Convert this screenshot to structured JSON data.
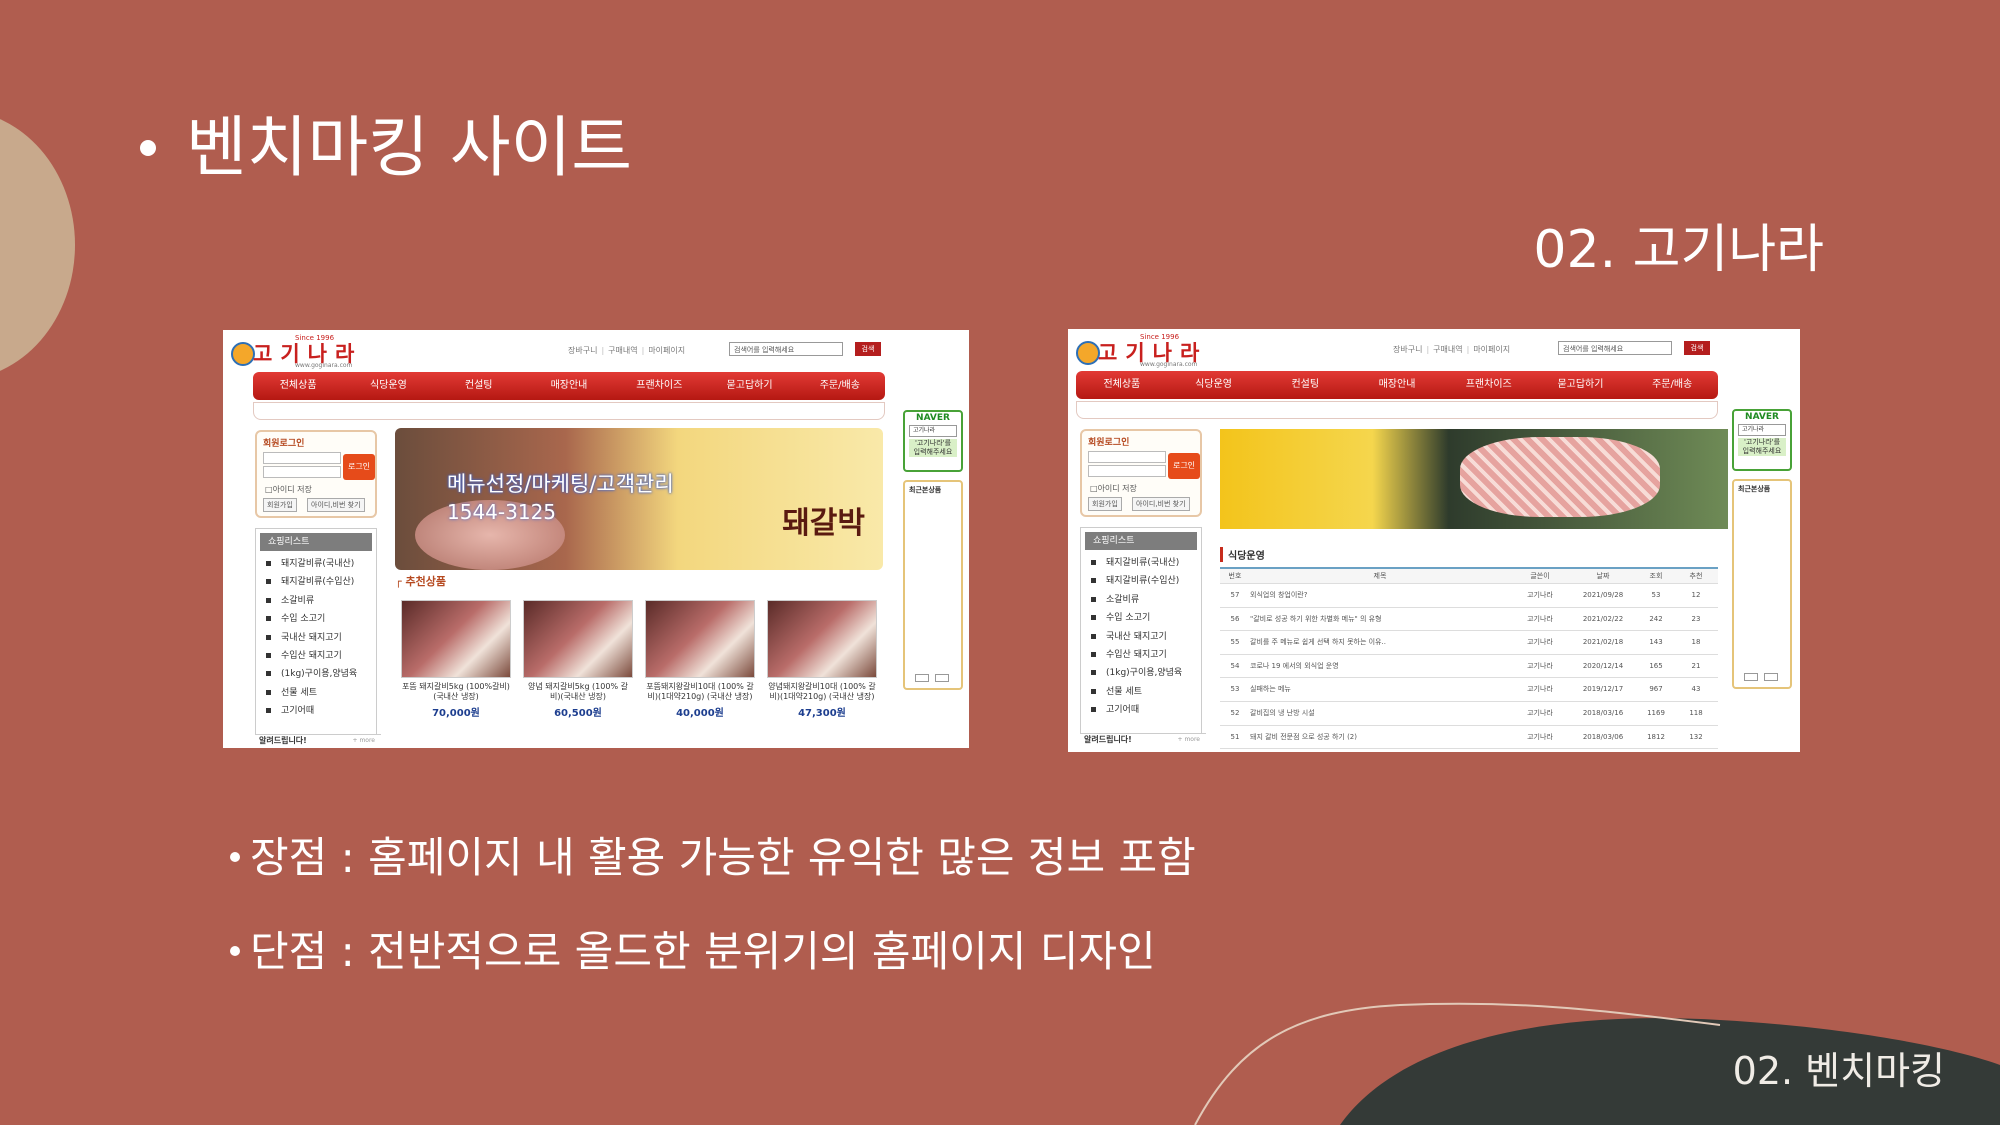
{
  "slide": {
    "title": "벤치마킹 사이트",
    "subtitle": "02. 고기나라",
    "bullets": [
      "장점 : 홈페이지 내 활용 가능한 유익한 많은 정보 포함",
      "단점 : 전반적으로 올드한 분위기의 홈페이지 디자인"
    ],
    "footer": "02. 벤치마킹",
    "colors": {
      "background": "#b05d4f",
      "accent_shape": "#c8a98c",
      "dark_shape": "#343a37"
    }
  },
  "site": {
    "logo": "고기나라",
    "since": "Since 1996",
    "domain": "www.goginara.com",
    "util_links": [
      "장바구니",
      "구매내역",
      "마이페이지"
    ],
    "search_placeholder": "검색어를 입력해세요",
    "search_button": "검색",
    "nav": [
      "전체상품",
      "식당운영",
      "컨설팅",
      "매장안내",
      "프랜차이즈",
      "묻고답하기",
      "주문/배송"
    ],
    "login": {
      "title": "회원로그인",
      "button": "로그인",
      "save_id": "아이디 저장",
      "join": "회원가입",
      "find": "아이디,비번 찾기"
    },
    "shop": {
      "title": "쇼핑리스트",
      "items": [
        "돼지갈비류(국내산)",
        "돼지갈비류(수입산)",
        "소갈비류",
        "수입 소고기",
        "국내산 돼지고기",
        "수입산 돼지고기",
        "(1kg)구이용,양념육",
        "선물 세트",
        "고기어때"
      ]
    },
    "alarm": {
      "title": "알려드립니다!",
      "more": "+ more"
    },
    "naver": {
      "brand": "NAVER",
      "select": "고기나라",
      "text1": "'고기나라'를",
      "text2": "입력해주세요"
    },
    "recent": "최근본상품",
    "banner": {
      "line1": "메뉴선정/마케팅/고객관리",
      "line2": "1544-3125",
      "brand": "돼갈박"
    },
    "recommend": "추천상품",
    "products": [
      {
        "name": "포뜸 돼지갈비5kg (100%갈비)(국내산 냉장)",
        "price": "70,000원"
      },
      {
        "name": "양념 돼지갈비5kg (100% 갈비)(국내산 냉장)",
        "price": "60,500원"
      },
      {
        "name": "포뜸돼지왕갈비10대 (100% 갈비)(1대약210g) (국내산 냉장)",
        "price": "40,000원"
      },
      {
        "name": "양념돼지왕갈비10대 (100% 갈비)(1대약210g) (국내산 냉장)",
        "price": "47,300원"
      }
    ],
    "board": {
      "title": "식당운영",
      "headers": [
        "번호",
        "제목",
        "글쓴이",
        "날짜",
        "조회",
        "추천"
      ],
      "rows": [
        [
          "57",
          "외식업의 창업이란?",
          "고기나라",
          "2021/09/28",
          "53",
          "12"
        ],
        [
          "56",
          "\"갈비로 성공 하기 위한 차별화 메뉴\" 의 유형",
          "고기나라",
          "2021/02/22",
          "242",
          "23"
        ],
        [
          "55",
          "갈비를 주 메뉴로 쉽게 선택 하지 못하는 이유..",
          "고기나라",
          "2021/02/18",
          "143",
          "18"
        ],
        [
          "54",
          "코로나 19 에서의 외식업 운영",
          "고기나라",
          "2020/12/14",
          "165",
          "21"
        ],
        [
          "53",
          "실패하는 메뉴",
          "고기나라",
          "2019/12/17",
          "967",
          "43"
        ],
        [
          "52",
          "갈비집의 냉 난방 시설",
          "고기나라",
          "2018/03/16",
          "1169",
          "118"
        ],
        [
          "51",
          "돼지 갈비 전문점 으로 성공 하기 (2)",
          "고기나라",
          "2018/03/06",
          "1812",
          "132"
        ]
      ]
    }
  }
}
